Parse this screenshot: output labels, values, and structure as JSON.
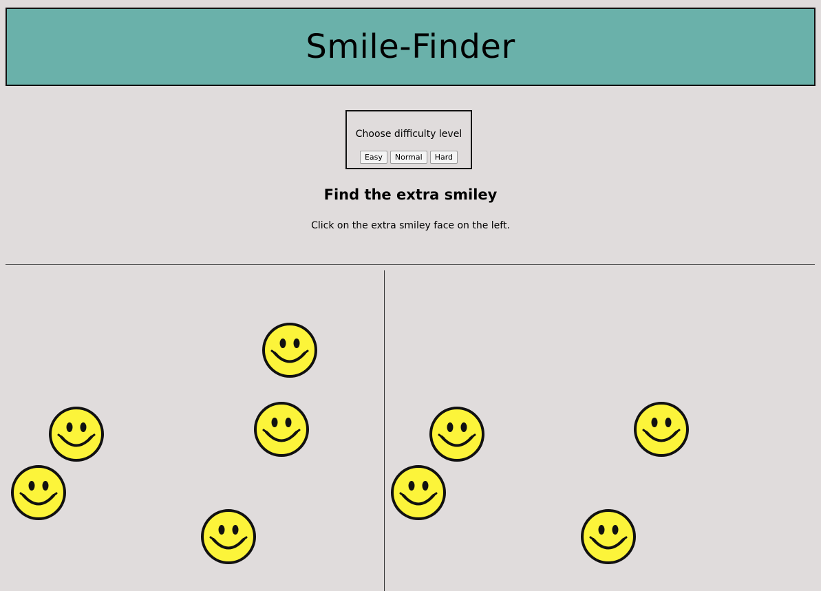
{
  "header": {
    "title": "Smile-Finder"
  },
  "difficulty": {
    "label": "Choose difficulty level",
    "buttons": [
      "Easy",
      "Normal",
      "Hard"
    ]
  },
  "game": {
    "heading": "Find the extra smiley",
    "instructions": "Click on the extra smiley face on the left.",
    "left_smiley_count": 5,
    "right_smiley_count": 4
  },
  "colors": {
    "background": "#e0dcdc",
    "header_bg": "#6ab1aa",
    "smiley_fill": "#fcf43a",
    "smiley_outline": "#111111"
  },
  "icons": {
    "smiley": "smiley-face-icon"
  }
}
